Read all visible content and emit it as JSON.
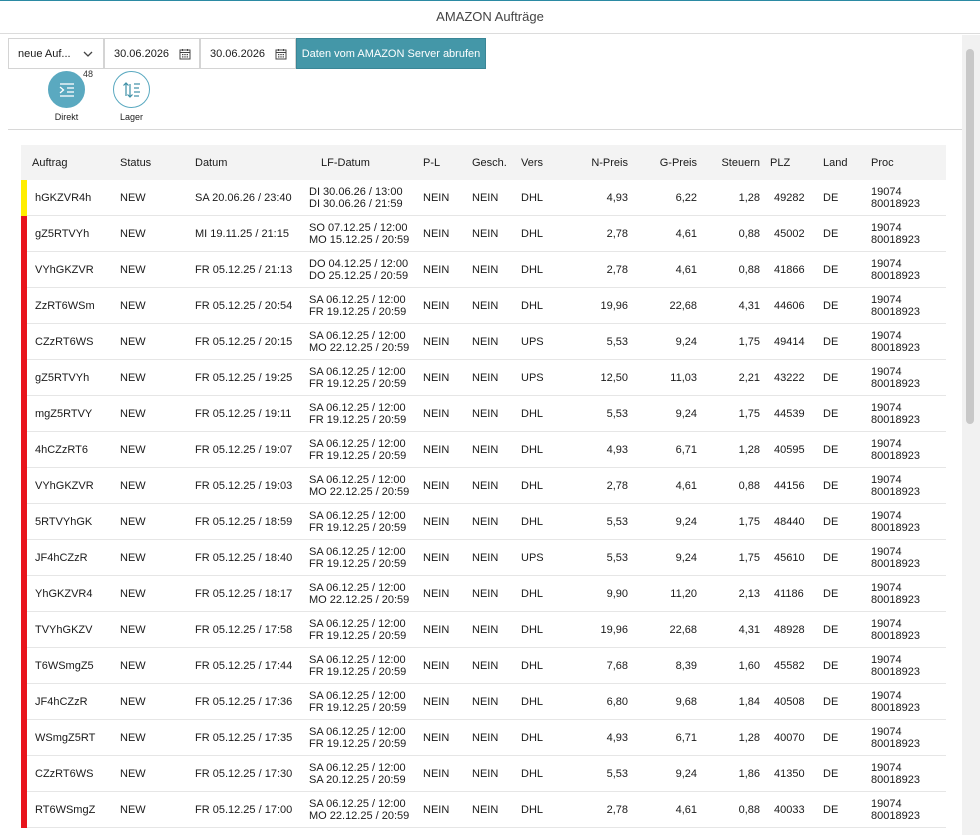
{
  "window": {
    "title": "AMAZON Aufträge"
  },
  "toolbar": {
    "filter_value": "neue Auf...",
    "date_from": "30.06.2026",
    "date_to": "30.06.2026",
    "fetch_label": "Daten vom AMAZON Server abrufen"
  },
  "modes": [
    {
      "label": "Direkt",
      "badge": "48",
      "active": true
    },
    {
      "label": "Lager",
      "badge": "",
      "active": false
    }
  ],
  "colors": {
    "accent": "#4497a8",
    "stripe_yellow": "#ffee00",
    "stripe_red": "#e8141c"
  },
  "table": {
    "headers": [
      "Auftrag",
      "Status",
      "Datum",
      "LF-Datum",
      "P-L",
      "Gesch.",
      "Vers",
      "N-Preis",
      "G-Preis",
      "Steuern",
      "PLZ",
      "Land",
      "Proc"
    ],
    "rows": [
      {
        "stripe": "yellow",
        "auftrag": "hGKZVR4h",
        "status": "NEW",
        "datum": "SA 20.06.26 / 23:40",
        "lf1": "DI 30.06.26 / 13:00",
        "lf2": "DI 30.06.26 / 21:59",
        "pl": "NEIN",
        "gesch": "NEIN",
        "vers": "DHL",
        "npreis": "4,93",
        "gpreis": "6,22",
        "steuern": "1,28",
        "plz": "49282",
        "land": "DE",
        "proc1": "19074",
        "proc2": "80018923"
      },
      {
        "stripe": "red",
        "auftrag": "gZ5RTVYh",
        "status": "NEW",
        "datum": "MI 19.11.25 / 21:15",
        "lf1": "SO 07.12.25 / 12:00",
        "lf2": "MO 15.12.25 / 20:59",
        "pl": "NEIN",
        "gesch": "NEIN",
        "vers": "DHL",
        "npreis": "2,78",
        "gpreis": "4,61",
        "steuern": "0,88",
        "plz": "45002",
        "land": "DE",
        "proc1": "19074",
        "proc2": "80018923"
      },
      {
        "stripe": "red",
        "auftrag": "VYhGKZVR",
        "status": "NEW",
        "datum": "FR 05.12.25 / 21:13",
        "lf1": "DO 04.12.25 / 12:00",
        "lf2": "DO 25.12.25 / 20:59",
        "pl": "NEIN",
        "gesch": "NEIN",
        "vers": "DHL",
        "npreis": "2,78",
        "gpreis": "4,61",
        "steuern": "0,88",
        "plz": "41866",
        "land": "DE",
        "proc1": "19074",
        "proc2": "80018923"
      },
      {
        "stripe": "red",
        "auftrag": "ZzRT6WSm",
        "status": "NEW",
        "datum": "FR 05.12.25 / 20:54",
        "lf1": "SA 06.12.25 / 12:00",
        "lf2": "FR 19.12.25 / 20:59",
        "pl": "NEIN",
        "gesch": "NEIN",
        "vers": "DHL",
        "npreis": "19,96",
        "gpreis": "22,68",
        "steuern": "4,31",
        "plz": "44606",
        "land": "DE",
        "proc1": "19074",
        "proc2": "80018923"
      },
      {
        "stripe": "red",
        "auftrag": "CZzRT6WS",
        "status": "NEW",
        "datum": "FR 05.12.25 / 20:15",
        "lf1": "SA 06.12.25 / 12:00",
        "lf2": "MO 22.12.25 / 20:59",
        "pl": "NEIN",
        "gesch": "NEIN",
        "vers": "UPS",
        "npreis": "5,53",
        "gpreis": "9,24",
        "steuern": "1,75",
        "plz": "49414",
        "land": "DE",
        "proc1": "19074",
        "proc2": "80018923"
      },
      {
        "stripe": "red",
        "auftrag": "gZ5RTVYh",
        "status": "NEW",
        "datum": "FR 05.12.25 / 19:25",
        "lf1": "SA 06.12.25 / 12:00",
        "lf2": "FR 19.12.25 / 20:59",
        "pl": "NEIN",
        "gesch": "NEIN",
        "vers": "UPS",
        "npreis": "12,50",
        "gpreis": "11,03",
        "steuern": "2,21",
        "plz": "43222",
        "land": "DE",
        "proc1": "19074",
        "proc2": "80018923"
      },
      {
        "stripe": "red",
        "auftrag": "mgZ5RTVY",
        "status": "NEW",
        "datum": "FR 05.12.25 / 19:11",
        "lf1": "SA 06.12.25 / 12:00",
        "lf2": "FR 19.12.25 / 20:59",
        "pl": "NEIN",
        "gesch": "NEIN",
        "vers": "DHL",
        "npreis": "5,53",
        "gpreis": "9,24",
        "steuern": "1,75",
        "plz": "44539",
        "land": "DE",
        "proc1": "19074",
        "proc2": "80018923"
      },
      {
        "stripe": "red",
        "auftrag": "4hCZzRT6",
        "status": "NEW",
        "datum": "FR 05.12.25 / 19:07",
        "lf1": "SA 06.12.25 / 12:00",
        "lf2": "FR 19.12.25 / 20:59",
        "pl": "NEIN",
        "gesch": "NEIN",
        "vers": "DHL",
        "npreis": "4,93",
        "gpreis": "6,71",
        "steuern": "1,28",
        "plz": "40595",
        "land": "DE",
        "proc1": "19074",
        "proc2": "80018923"
      },
      {
        "stripe": "red",
        "auftrag": "VYhGKZVR",
        "status": "NEW",
        "datum": "FR 05.12.25 / 19:03",
        "lf1": "SA 06.12.25 / 12:00",
        "lf2": "MO 22.12.25 / 20:59",
        "pl": "NEIN",
        "gesch": "NEIN",
        "vers": "DHL",
        "npreis": "2,78",
        "gpreis": "4,61",
        "steuern": "0,88",
        "plz": "44156",
        "land": "DE",
        "proc1": "19074",
        "proc2": "80018923"
      },
      {
        "stripe": "red",
        "auftrag": "5RTVYhGK",
        "status": "NEW",
        "datum": "FR 05.12.25 / 18:59",
        "lf1": "SA 06.12.25 / 12:00",
        "lf2": "FR 19.12.25 / 20:59",
        "pl": "NEIN",
        "gesch": "NEIN",
        "vers": "DHL",
        "npreis": "5,53",
        "gpreis": "9,24",
        "steuern": "1,75",
        "plz": "48440",
        "land": "DE",
        "proc1": "19074",
        "proc2": "80018923"
      },
      {
        "stripe": "red",
        "auftrag": "JF4hCZzR",
        "status": "NEW",
        "datum": "FR 05.12.25 / 18:40",
        "lf1": "SA 06.12.25 / 12:00",
        "lf2": "FR 19.12.25 / 20:59",
        "pl": "NEIN",
        "gesch": "NEIN",
        "vers": "UPS",
        "npreis": "5,53",
        "gpreis": "9,24",
        "steuern": "1,75",
        "plz": "45610",
        "land": "DE",
        "proc1": "19074",
        "proc2": "80018923"
      },
      {
        "stripe": "red",
        "auftrag": "YhGKZVR4",
        "status": "NEW",
        "datum": "FR 05.12.25 / 18:17",
        "lf1": "SA 06.12.25 / 12:00",
        "lf2": "MO 22.12.25 / 20:59",
        "pl": "NEIN",
        "gesch": "NEIN",
        "vers": "DHL",
        "npreis": "9,90",
        "gpreis": "11,20",
        "steuern": "2,13",
        "plz": "41186",
        "land": "DE",
        "proc1": "19074",
        "proc2": "80018923"
      },
      {
        "stripe": "red",
        "auftrag": "TVYhGKZV",
        "status": "NEW",
        "datum": "FR 05.12.25 / 17:58",
        "lf1": "SA 06.12.25 / 12:00",
        "lf2": "FR 19.12.25 / 20:59",
        "pl": "NEIN",
        "gesch": "NEIN",
        "vers": "DHL",
        "npreis": "19,96",
        "gpreis": "22,68",
        "steuern": "4,31",
        "plz": "48928",
        "land": "DE",
        "proc1": "19074",
        "proc2": "80018923"
      },
      {
        "stripe": "red",
        "auftrag": "T6WSmgZ5",
        "status": "NEW",
        "datum": "FR 05.12.25 / 17:44",
        "lf1": "SA 06.12.25 / 12:00",
        "lf2": "FR 19.12.25 / 20:59",
        "pl": "NEIN",
        "gesch": "NEIN",
        "vers": "DHL",
        "npreis": "7,68",
        "gpreis": "8,39",
        "steuern": "1,60",
        "plz": "45582",
        "land": "DE",
        "proc1": "19074",
        "proc2": "80018923"
      },
      {
        "stripe": "red",
        "auftrag": "JF4hCZzR",
        "status": "NEW",
        "datum": "FR 05.12.25 / 17:36",
        "lf1": "SA 06.12.25 / 12:00",
        "lf2": "FR 19.12.25 / 20:59",
        "pl": "NEIN",
        "gesch": "NEIN",
        "vers": "DHL",
        "npreis": "6,80",
        "gpreis": "9,68",
        "steuern": "1,84",
        "plz": "40508",
        "land": "DE",
        "proc1": "19074",
        "proc2": "80018923"
      },
      {
        "stripe": "red",
        "auftrag": "WSmgZ5RT",
        "status": "NEW",
        "datum": "FR 05.12.25 / 17:35",
        "lf1": "SA 06.12.25 / 12:00",
        "lf2": "FR 19.12.25 / 20:59",
        "pl": "NEIN",
        "gesch": "NEIN",
        "vers": "DHL",
        "npreis": "4,93",
        "gpreis": "6,71",
        "steuern": "1,28",
        "plz": "40070",
        "land": "DE",
        "proc1": "19074",
        "proc2": "80018923"
      },
      {
        "stripe": "red",
        "auftrag": "CZzRT6WS",
        "status": "NEW",
        "datum": "FR 05.12.25 / 17:30",
        "lf1": "SA 06.12.25 / 12:00",
        "lf2": "SA 20.12.25 / 20:59",
        "pl": "NEIN",
        "gesch": "NEIN",
        "vers": "DHL",
        "npreis": "5,53",
        "gpreis": "9,24",
        "steuern": "1,86",
        "plz": "41350",
        "land": "DE",
        "proc1": "19074",
        "proc2": "80018923"
      },
      {
        "stripe": "red",
        "auftrag": "RT6WSmgZ",
        "status": "NEW",
        "datum": "FR 05.12.25 / 17:00",
        "lf1": "SA 06.12.25 / 12:00",
        "lf2": "MO 22.12.25 / 20:59",
        "pl": "NEIN",
        "gesch": "NEIN",
        "vers": "DHL",
        "npreis": "2,78",
        "gpreis": "4,61",
        "steuern": "0,88",
        "plz": "40033",
        "land": "DE",
        "proc1": "19074",
        "proc2": "80018923"
      }
    ]
  }
}
